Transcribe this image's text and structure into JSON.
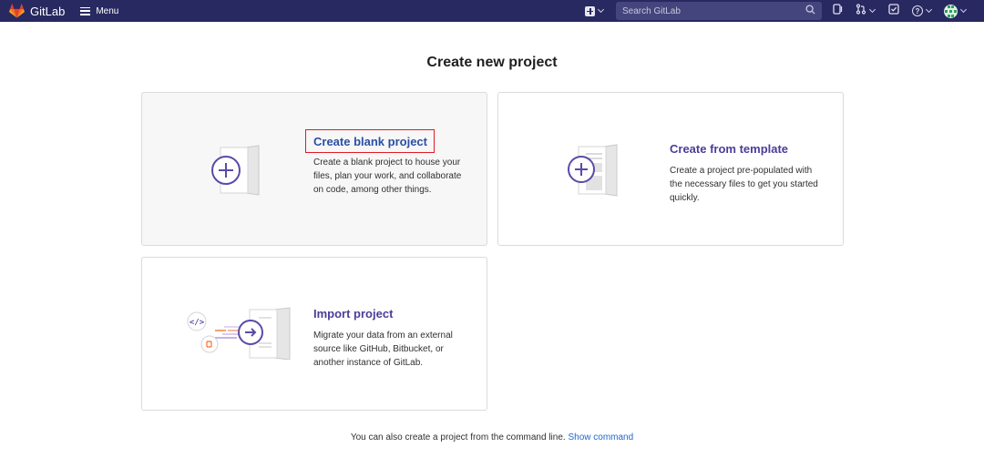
{
  "navbar": {
    "brand": "GitLab",
    "menu_label": "Menu",
    "search_placeholder": "Search GitLab",
    "colors": {
      "background": "#292961",
      "search_bg": "#45457e"
    },
    "icons": [
      "gitlab-logo-icon",
      "menu-icon",
      "create-new-icon",
      "search-icon",
      "issues-icon",
      "merge-requests-icon",
      "todos-icon",
      "help-icon",
      "user-avatar"
    ]
  },
  "page": {
    "title": "Create new project"
  },
  "cards": {
    "blank": {
      "title": "Create blank project",
      "description": "Create a blank project to house your files, plan your work, and collaborate on code, among other things."
    },
    "template": {
      "title": "Create from template",
      "description": "Create a project pre-populated with the necessary files to get you started quickly."
    },
    "import": {
      "title": "Import project",
      "description": "Migrate your data from an external source like GitHub, Bitbucket, or another instance of GitLab."
    }
  },
  "footer": {
    "text": "You can also create a project from the command line.",
    "link": "Show command"
  },
  "colors": {
    "accent_purple": "#4b3d98",
    "link_blue": "#1f67c8",
    "highlight_red": "#e21b23"
  }
}
